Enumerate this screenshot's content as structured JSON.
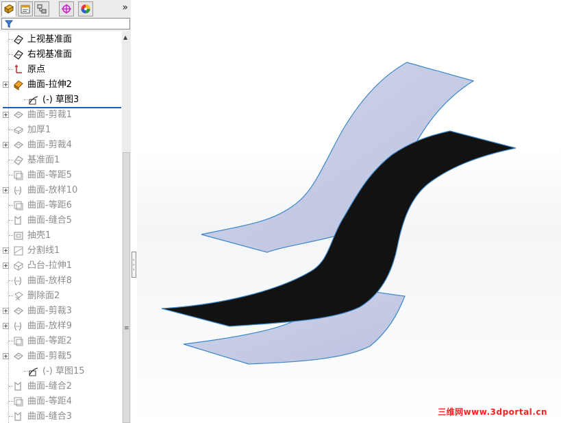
{
  "tabs": [
    {
      "name": "feature-tree-tab",
      "icon": "feature-tree-icon"
    },
    {
      "name": "property-tab",
      "icon": "property-manager-icon"
    },
    {
      "name": "configuration-tab",
      "icon": "configuration-manager-icon"
    },
    {
      "name": "dimxpert-tab",
      "icon": "dimxpert-icon"
    },
    {
      "name": "display-tab",
      "icon": "display-manager-icon"
    }
  ],
  "more_tabs_label": "»",
  "filter": {
    "icon": "filter-icon",
    "value": ""
  },
  "tree": {
    "items": [
      {
        "label": "上视基准面",
        "icon": "plane-icon",
        "state": "active"
      },
      {
        "label": "右视基准面",
        "icon": "plane-icon",
        "state": "active"
      },
      {
        "label": "原点",
        "icon": "origin-icon",
        "state": "active"
      },
      {
        "label": "曲面-拉伸2",
        "icon": "surface-extrude-icon",
        "state": "active"
      },
      {
        "label": "(-) 草图3",
        "icon": "sketch-icon",
        "state": "active"
      },
      {
        "label": "曲面-剪裁1",
        "icon": "surface-trim-icon",
        "state": "suppressed"
      },
      {
        "label": "加厚1",
        "icon": "thicken-icon",
        "state": "suppressed"
      },
      {
        "label": "曲面-剪裁4",
        "icon": "surface-trim-icon",
        "state": "suppressed"
      },
      {
        "label": "基准面1",
        "icon": "plane-icon",
        "state": "suppressed"
      },
      {
        "label": "曲面-等距5",
        "icon": "surface-offset-icon",
        "state": "suppressed"
      },
      {
        "label": "曲面-放样10",
        "icon": "surface-loft-icon",
        "state": "suppressed"
      },
      {
        "label": "曲面-等距6",
        "icon": "surface-offset-icon",
        "state": "suppressed"
      },
      {
        "label": "曲面-缝合5",
        "icon": "surface-knit-icon",
        "state": "suppressed"
      },
      {
        "label": "抽壳1",
        "icon": "shell-icon",
        "state": "suppressed"
      },
      {
        "label": "分割线1",
        "icon": "split-line-icon",
        "state": "suppressed"
      },
      {
        "label": "凸台-拉伸1",
        "icon": "boss-extrude-icon",
        "state": "suppressed"
      },
      {
        "label": "曲面-放样8",
        "icon": "surface-loft-icon",
        "state": "suppressed"
      },
      {
        "label": "删除面2",
        "icon": "delete-face-icon",
        "state": "suppressed"
      },
      {
        "label": "曲面-剪裁3",
        "icon": "surface-trim-icon",
        "state": "suppressed"
      },
      {
        "label": "曲面-放样9",
        "icon": "surface-loft-icon",
        "state": "suppressed"
      },
      {
        "label": "曲面-等距2",
        "icon": "surface-offset-icon",
        "state": "suppressed"
      },
      {
        "label": "曲面-剪裁5",
        "icon": "surface-trim-icon",
        "state": "suppressed"
      },
      {
        "label": "(-) 草图15",
        "icon": "sketch-icon",
        "state": "suppressed"
      },
      {
        "label": "曲面-缝合2",
        "icon": "surface-knit-icon",
        "state": "suppressed"
      },
      {
        "label": "曲面-等距4",
        "icon": "surface-offset-icon",
        "state": "suppressed"
      },
      {
        "label": "曲面-缝合3",
        "icon": "surface-knit-icon",
        "state": "suppressed"
      }
    ]
  },
  "viewport": {
    "surface_fill": "#c5cbe4",
    "surface_edge": "#3a86c8",
    "selected_fill": "#121212",
    "background_mid": "#f1f2f5"
  },
  "watermark": "三维网www.3dportal.cn",
  "colors": {
    "rollback_bar": "#1f5bb8",
    "suppressed_text": "#8c8c8c",
    "watermark": "#ff2020"
  }
}
